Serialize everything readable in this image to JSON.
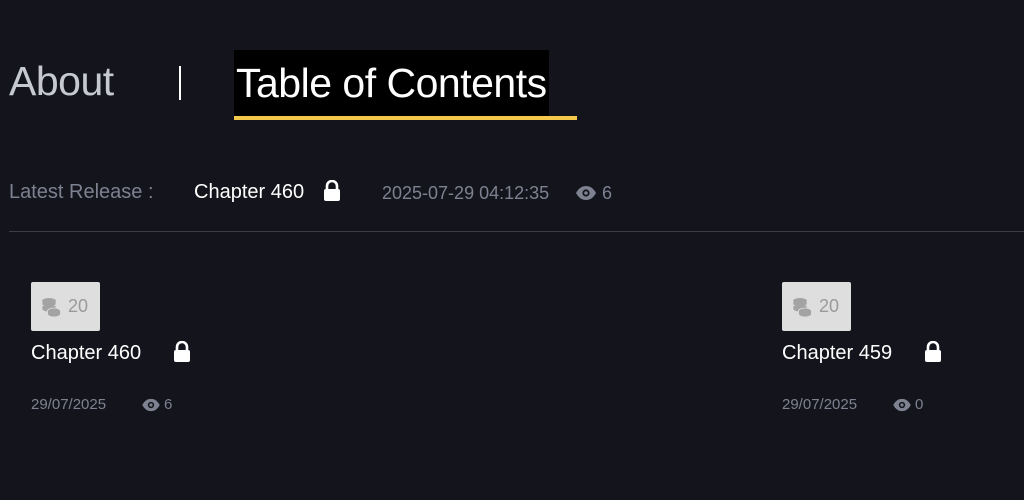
{
  "tabs": {
    "about_label": "About",
    "toc_label": "Table of Contents",
    "active": "Table of Contents"
  },
  "latest_release": {
    "label": "Latest Release :",
    "chapter": "Chapter 460",
    "locked": true,
    "timestamp": "2025-07-29 04:12:35",
    "views": "6"
  },
  "chapters": [
    {
      "price": "20",
      "title": "Chapter 460",
      "locked": true,
      "date": "29/07/2025",
      "views": "6"
    },
    {
      "price": "20",
      "title": "Chapter 459",
      "locked": true,
      "date": "29/07/2025",
      "views": "0"
    }
  ],
  "colors": {
    "background": "#14151c",
    "accent_underline": "#f3c84b",
    "muted_text": "#7d8190",
    "badge_bg": "#dedede"
  },
  "icons": {
    "lock": "lock-icon",
    "eye": "eye-icon",
    "coins": "coins-icon"
  }
}
